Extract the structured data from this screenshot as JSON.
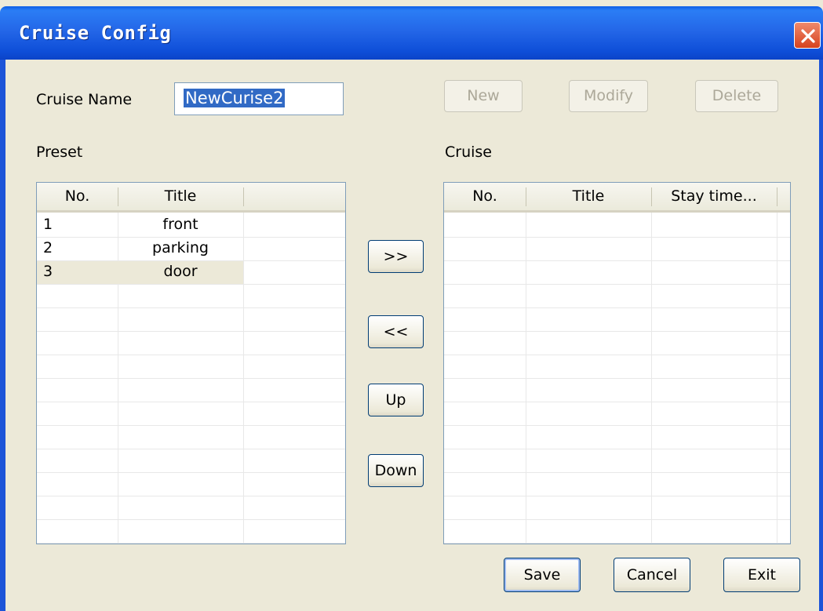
{
  "window": {
    "title": "Cruise Config"
  },
  "cruise_name": {
    "label": "Cruise Name",
    "value": "NewCurise2"
  },
  "toolbar": {
    "new_label": "New",
    "modify_label": "Modify",
    "delete_label": "Delete"
  },
  "preset": {
    "label": "Preset",
    "columns": [
      "No.",
      "Title"
    ],
    "rows": [
      {
        "no": "1",
        "title": "front"
      },
      {
        "no": "2",
        "title": "parking"
      },
      {
        "no": "3",
        "title": "door"
      }
    ]
  },
  "cruise": {
    "label": "Cruise",
    "columns": [
      "No.",
      "Title",
      "Stay time..."
    ]
  },
  "transfer": {
    "add_label": ">>",
    "remove_label": "<<",
    "up_label": "Up",
    "down_label": "Down"
  },
  "footer": {
    "save_label": "Save",
    "cancel_label": "Cancel",
    "exit_label": "Exit"
  },
  "colors": {
    "titlebar": "#2467e8",
    "dialog_bg": "#ece9d8",
    "selection": "#316ac5",
    "selected_row": "#ece9d8"
  }
}
